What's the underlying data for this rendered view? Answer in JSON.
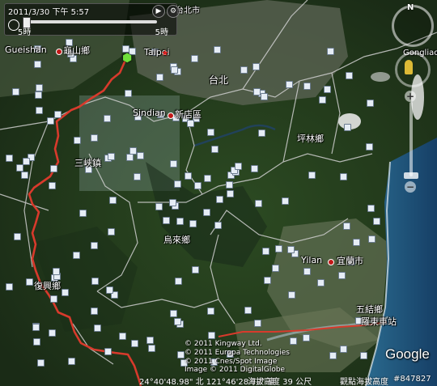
{
  "time_slider": {
    "caption": "2011/3/30 下午 5:57",
    "start": "5時",
    "end": "5時"
  },
  "places": {
    "guishan_en": "Gueishan",
    "guishan_zh": "龜山鄉",
    "taipei_en": "Taipei",
    "taipei_zh": "台北",
    "taipei_city": "台北市",
    "sindian_en": "Sindian",
    "sindian_zh": "新店區",
    "sansia": "三峽鎮",
    "pinglin": "坪林鄉",
    "wulai": "烏來鄉",
    "fusing": "復興鄉",
    "yilan_en": "Yilan",
    "yilan_zh": "宜蘭市",
    "wujie": "五結鄉",
    "luodong": "羅東車站",
    "gongliao": "Gongliao"
  },
  "credits": {
    "line1": "© 2011 Kingway Ltd.",
    "line2": "© 2011 Europa Technologies",
    "line3": "© 2011 Cnes/Spot Image",
    "line4": "Image © 2011 DigitalGlobe"
  },
  "status": {
    "coords": "24°40'48.98\" 北 121°46'28.72\" 東",
    "elev": "海拔高度  39 公尺",
    "eye": "觀點海拔高度",
    "imagery": "#847827"
  },
  "logo": "Google",
  "nav": {
    "north": "N"
  },
  "colors": {
    "track": "#d83a2c",
    "roads": "#c9c9c9",
    "ocean": "#1c4f7a"
  }
}
